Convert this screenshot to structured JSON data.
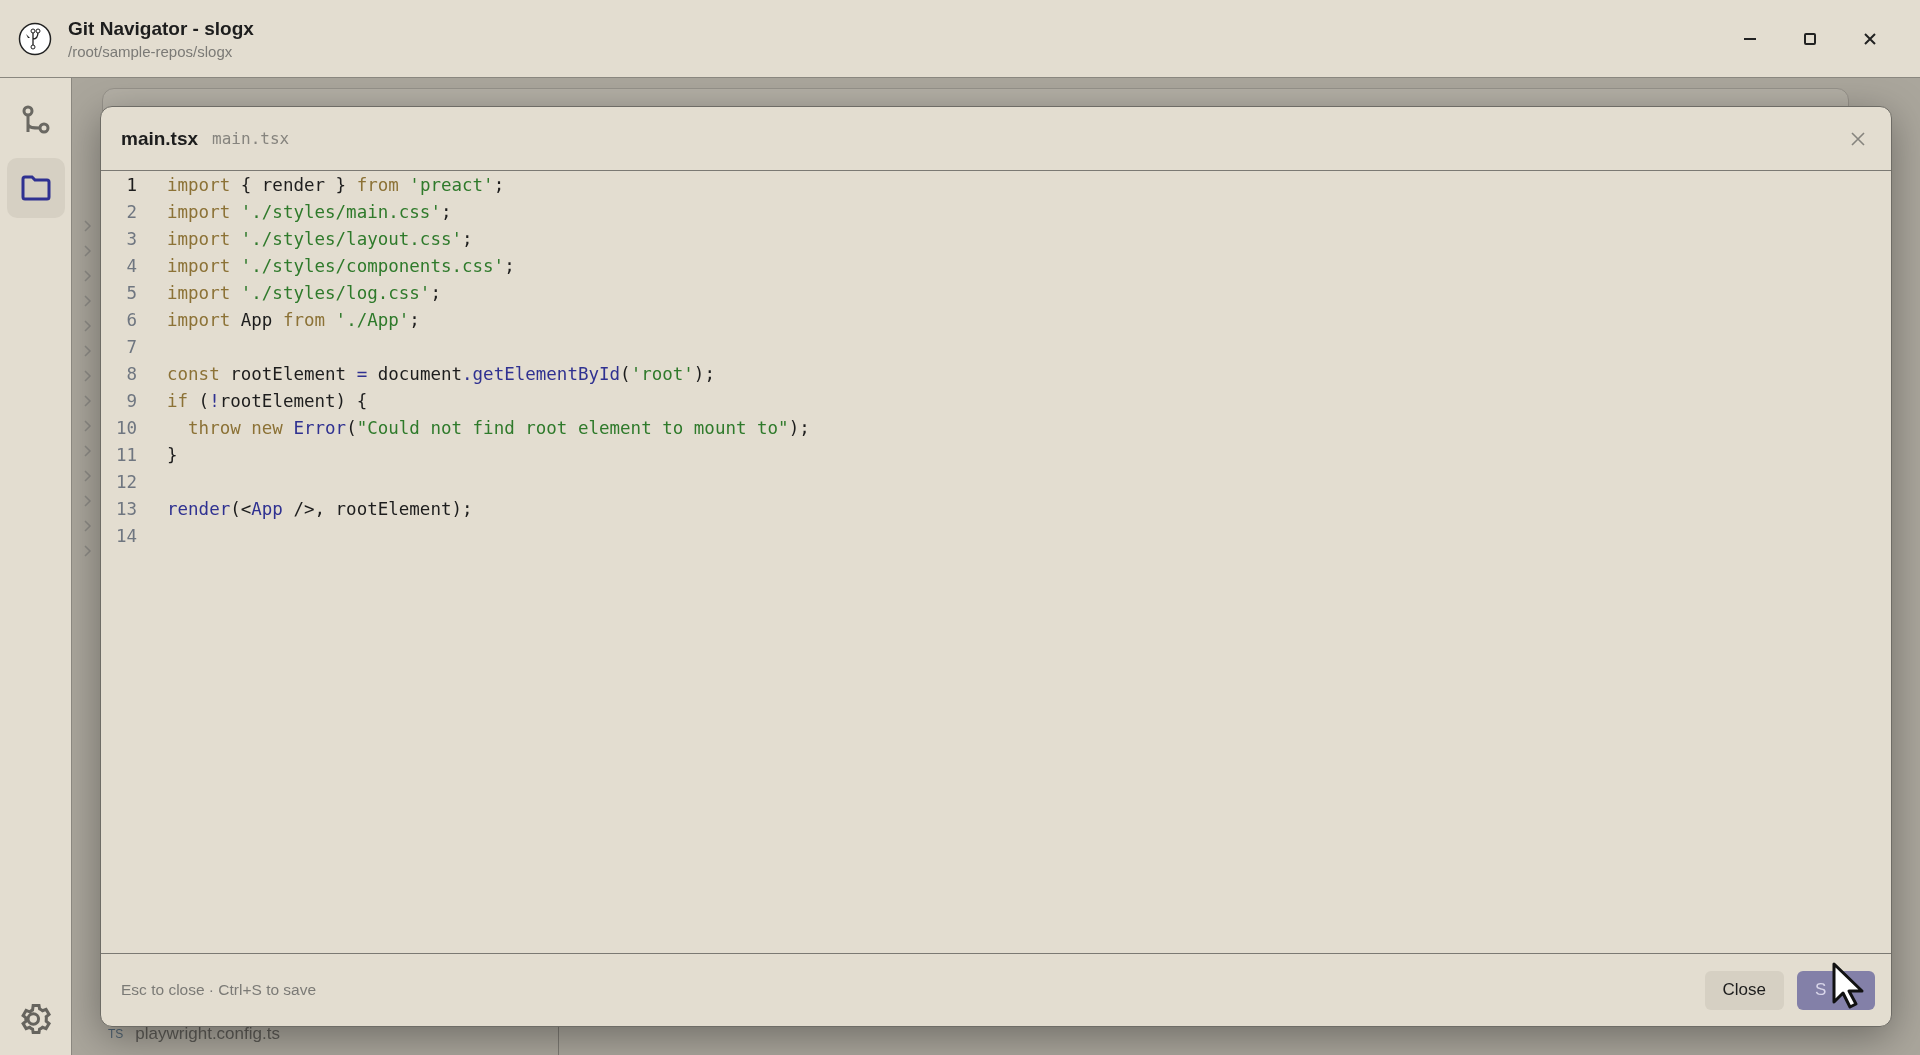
{
  "window": {
    "title": "Git Navigator - slogx",
    "subtitle": "/root/sample-repos/slogx"
  },
  "sidebar": {
    "items": [
      {
        "kind": "branch",
        "selected": false
      },
      {
        "kind": "folder",
        "selected": true
      }
    ]
  },
  "background": {
    "file": {
      "badge": "TS",
      "name": "playwright.config.ts"
    }
  },
  "dialog": {
    "title": "main.tsx",
    "path": "main.tsx",
    "lines": [
      {
        "number": "1",
        "current": true,
        "tokens": [
          {
            "kind": "keyword",
            "text": "import"
          },
          {
            "kind": "plain",
            "text": " { render } "
          },
          {
            "kind": "keyword",
            "text": "from"
          },
          {
            "kind": "string",
            "text": " 'preact'"
          },
          {
            "kind": "plain",
            "text": ";"
          }
        ]
      },
      {
        "number": "2",
        "current": false,
        "tokens": [
          {
            "kind": "keyword",
            "text": "import"
          },
          {
            "kind": "string",
            "text": " './styles/main.css'"
          },
          {
            "kind": "plain",
            "text": ";"
          }
        ]
      },
      {
        "number": "3",
        "current": false,
        "tokens": [
          {
            "kind": "keyword",
            "text": "import"
          },
          {
            "kind": "string",
            "text": " './styles/layout.css'"
          },
          {
            "kind": "plain",
            "text": ";"
          }
        ]
      },
      {
        "number": "4",
        "current": false,
        "tokens": [
          {
            "kind": "keyword",
            "text": "import"
          },
          {
            "kind": "string",
            "text": " './styles/components.css'"
          },
          {
            "kind": "plain",
            "text": ";"
          }
        ]
      },
      {
        "number": "5",
        "current": false,
        "tokens": [
          {
            "kind": "keyword",
            "text": "import"
          },
          {
            "kind": "string",
            "text": " './styles/log.css'"
          },
          {
            "kind": "plain",
            "text": ";"
          }
        ]
      },
      {
        "number": "6",
        "current": false,
        "tokens": [
          {
            "kind": "keyword",
            "text": "import"
          },
          {
            "kind": "plain",
            "text": " App "
          },
          {
            "kind": "keyword",
            "text": "from"
          },
          {
            "kind": "string",
            "text": " './App'"
          },
          {
            "kind": "plain",
            "text": ";"
          }
        ]
      },
      {
        "number": "7",
        "current": false
      },
      {
        "number": "8",
        "current": false,
        "tokens": [
          {
            "kind": "keyword",
            "text": "const"
          },
          {
            "kind": "plain",
            "text": " rootElement "
          },
          {
            "kind": "func",
            "text": "="
          },
          {
            "kind": "plain",
            "text": " document"
          },
          {
            "kind": "func",
            "text": ".getElementById"
          },
          {
            "kind": "plain",
            "text": "("
          },
          {
            "kind": "string",
            "text": "'root'"
          },
          {
            "kind": "plain",
            "text": ");"
          }
        ]
      },
      {
        "number": "9",
        "current": false,
        "tokens": [
          {
            "kind": "keyword",
            "text": "if"
          },
          {
            "kind": "plain",
            "text": " ("
          },
          {
            "kind": "func",
            "text": "!"
          },
          {
            "kind": "plain",
            "text": "rootElement) {"
          }
        ]
      },
      {
        "number": "10",
        "current": false,
        "tokens": [
          {
            "kind": "keyword",
            "text": "  throw new"
          },
          {
            "kind": "func",
            "text": " Error"
          },
          {
            "kind": "plain",
            "text": "("
          },
          {
            "kind": "string",
            "text": "\"Could not find root element to mount to\""
          },
          {
            "kind": "plain",
            "text": ");"
          }
        ]
      },
      {
        "number": "11",
        "current": false,
        "tokens": [
          {
            "kind": "plain",
            "text": "}"
          }
        ]
      },
      {
        "number": "12",
        "current": false
      },
      {
        "number": "13",
        "current": false,
        "tokens": [
          {
            "kind": "func",
            "text": "render"
          },
          {
            "kind": "plain",
            "text": "(<"
          },
          {
            "kind": "func",
            "text": "App"
          },
          {
            "kind": "plain",
            "text": " />, rootElement);"
          }
        ]
      },
      {
        "number": "14",
        "current": false
      }
    ],
    "hint": "Esc to close · Ctrl+S to save",
    "buttons": [
      {
        "kind": "secondary",
        "label": "Close"
      },
      {
        "kind": "primary",
        "label": "S"
      }
    ]
  }
}
